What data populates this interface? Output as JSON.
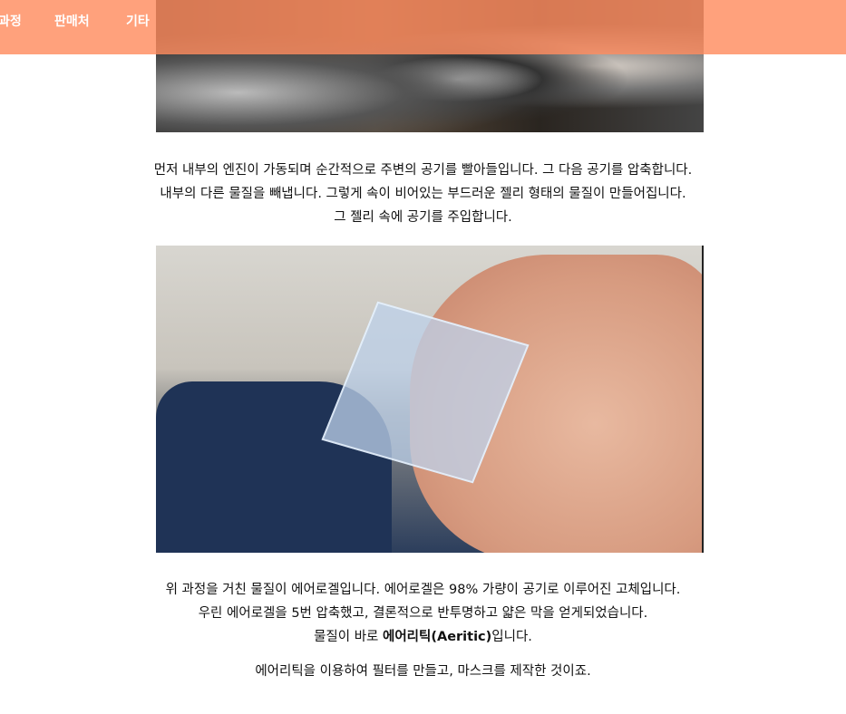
{
  "nav": {
    "items": [
      "과정",
      "판매처",
      "기타"
    ],
    "color": "#ff8c5f"
  },
  "paragraph1": [
    "먼저 내부의 엔진이 가동되며 순간적으로 주변의 공기를 빨아들입니다. 그 다음 공기를 압축합니다.",
    "내부의 다른 물질을 빼냅니다. 그렇게 속이 비어있는 부드러운 젤리 형태의 물질이 만들어집니다.",
    "그 젤리 속에 공기를 주입합니다."
  ],
  "paragraph2": [
    "위 과정을 거친 물질이 에어로겔입니다. 에어로겔은 98% 가량이 공기로 이루어진 고체입니다.",
    "우린 에어로겔을 5번 압축했고, 결론적으로 반투명하고 얇은 막을 얻게되었습니다."
  ],
  "paragraph2_line3": {
    "before": "물질이 바로 ",
    "bold": "에어리틱(Aeritic)",
    "after": "입니다."
  },
  "paragraph3": "에어리틱을 이용하여 필터를 만들고, 마스크를 제작한 것이죠."
}
